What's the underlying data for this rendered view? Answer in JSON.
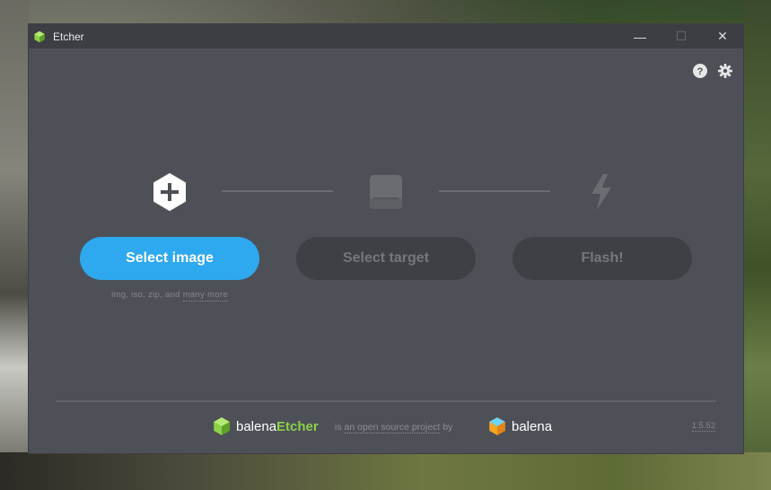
{
  "window": {
    "title": "Etcher",
    "controls": {
      "minimize": "—",
      "maximize": "☐",
      "close": "✕"
    }
  },
  "top_icons": [
    "help-icon",
    "settings-icon"
  ],
  "steps": {
    "image": {
      "icon": "plus-hexagon-icon",
      "button_label": "Select image",
      "hint": "img, iso, zip, and",
      "hint_link": "many more"
    },
    "target": {
      "icon": "drive-icon",
      "button_label": "Select target"
    },
    "flash": {
      "icon": "lightning-icon",
      "button_label": "Flash!"
    }
  },
  "footer": {
    "brand_prefix": "balena",
    "brand_suffix": "Etcher",
    "middle_is": "is",
    "middle_link": "an open source project",
    "middle_by": "by",
    "company": "balena",
    "version": "1.5.52"
  },
  "colors": {
    "window_bg": "#4d5057",
    "titlebar_bg": "#3c3e43",
    "primary": "#2ea8ee",
    "etcher_green": "#8bd14a",
    "disabled_bg": "#3e4045"
  }
}
